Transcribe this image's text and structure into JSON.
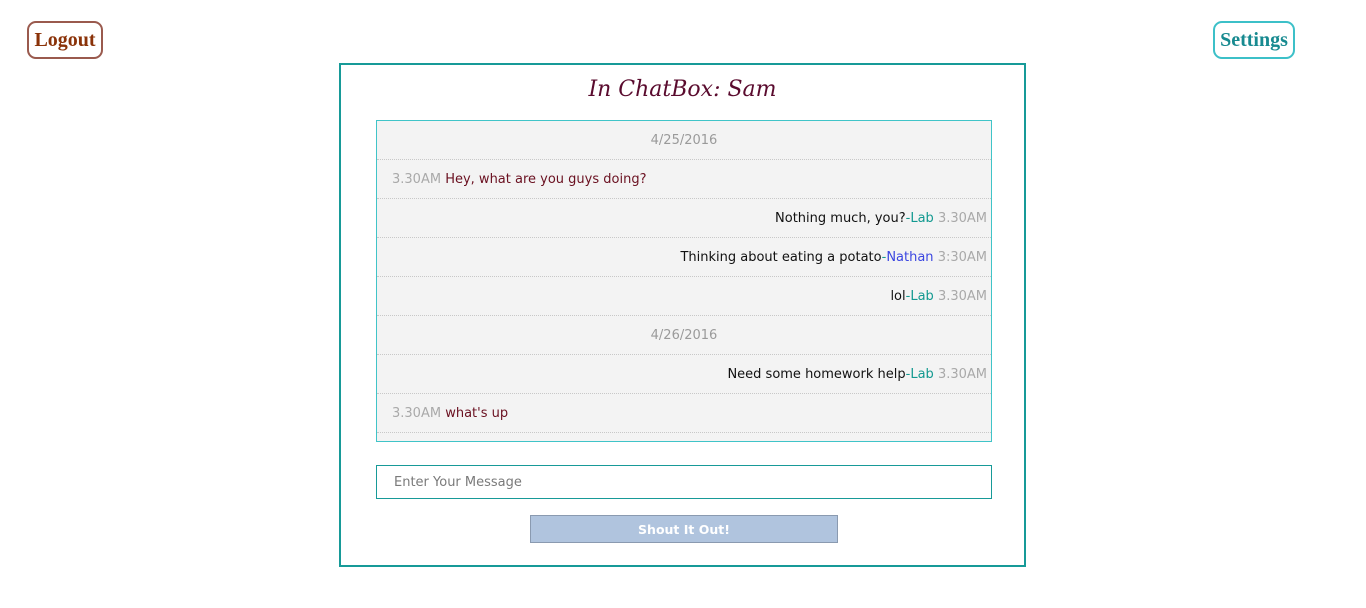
{
  "header": {
    "logout_label": "Logout",
    "settings_label": "Settings"
  },
  "chat": {
    "title": "In ChatBox: Sam",
    "separator": " - ",
    "dates": [
      "4/25/2016",
      "4/26/2016"
    ],
    "messages": [
      {
        "time": "3.30AM",
        "text": "Hey, what are you guys doing?"
      },
      {
        "time": "3.30AM",
        "text": "Nothing much, you?",
        "author": "Lab"
      },
      {
        "time": "3:30AM",
        "text": "Thinking about eating a potato",
        "author": "Nathan"
      },
      {
        "time": "3.30AM",
        "text": "lol",
        "author": "Lab"
      },
      {
        "time": "3.30AM",
        "text": "Need some homework help",
        "author": "Lab"
      },
      {
        "time": "3.30AM",
        "text": "what's up"
      }
    ]
  },
  "composer": {
    "placeholder": "Enter Your Message",
    "submit_label": "Shout It Out!"
  },
  "colors": {
    "panel_border": "#179a98",
    "title": "#5a0b2e",
    "own_message": "#6a1020",
    "author_lab": "#129990",
    "author_nathan": "#3b46e0",
    "timestamp": "#a9a9a9",
    "button_bg": "#b0c4de"
  }
}
